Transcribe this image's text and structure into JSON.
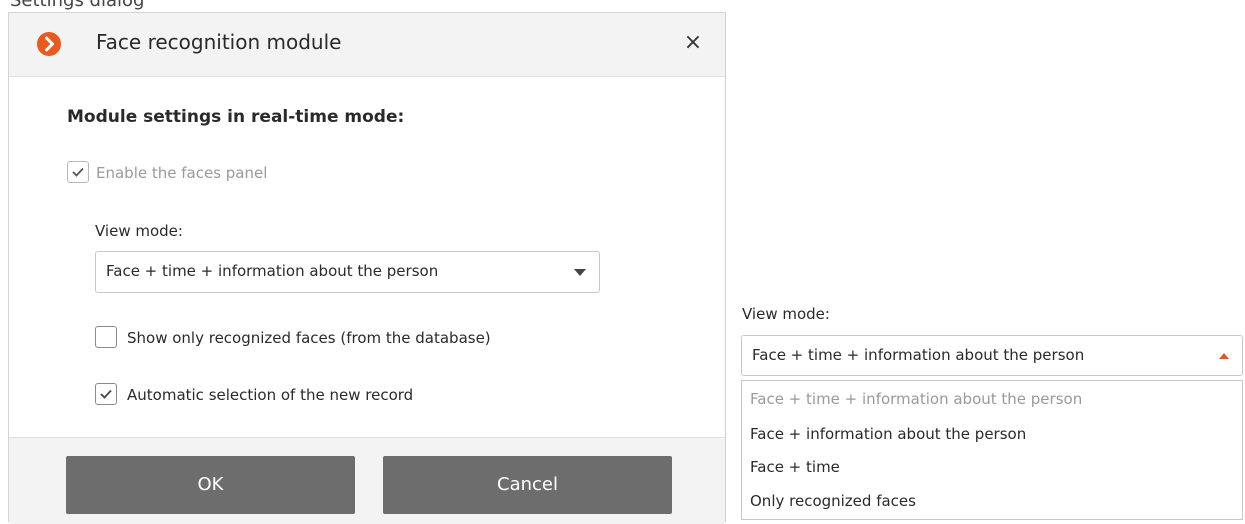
{
  "background": {
    "partial_heading": "Settings dialog"
  },
  "dialog": {
    "title": "Face recognition module",
    "close_label": "×",
    "section_title": "Module settings in real-time mode:",
    "enable_faces_panel": {
      "label": "Enable the faces panel",
      "checked": true,
      "disabled": true
    },
    "view_mode": {
      "label": "View mode:",
      "value": "Face + time + information about the person"
    },
    "show_only_recognized": {
      "label": "Show only recognized faces (from the database)",
      "checked": false
    },
    "auto_select_new_record": {
      "label": "Automatic selection of the new record",
      "checked": true
    },
    "ok_label": "OK",
    "cancel_label": "Cancel"
  },
  "view_mode_dropdown": {
    "label": "View mode:",
    "value": "Face + time + information about the person",
    "options": [
      "Face + time + information about the person",
      "Face + information about the person",
      "Face + time",
      "Only recognized faces"
    ],
    "selected_index": 0
  },
  "colors": {
    "accent": "#ea5a1f",
    "button": "#6d6d6d",
    "header": "#f3f3f3"
  }
}
